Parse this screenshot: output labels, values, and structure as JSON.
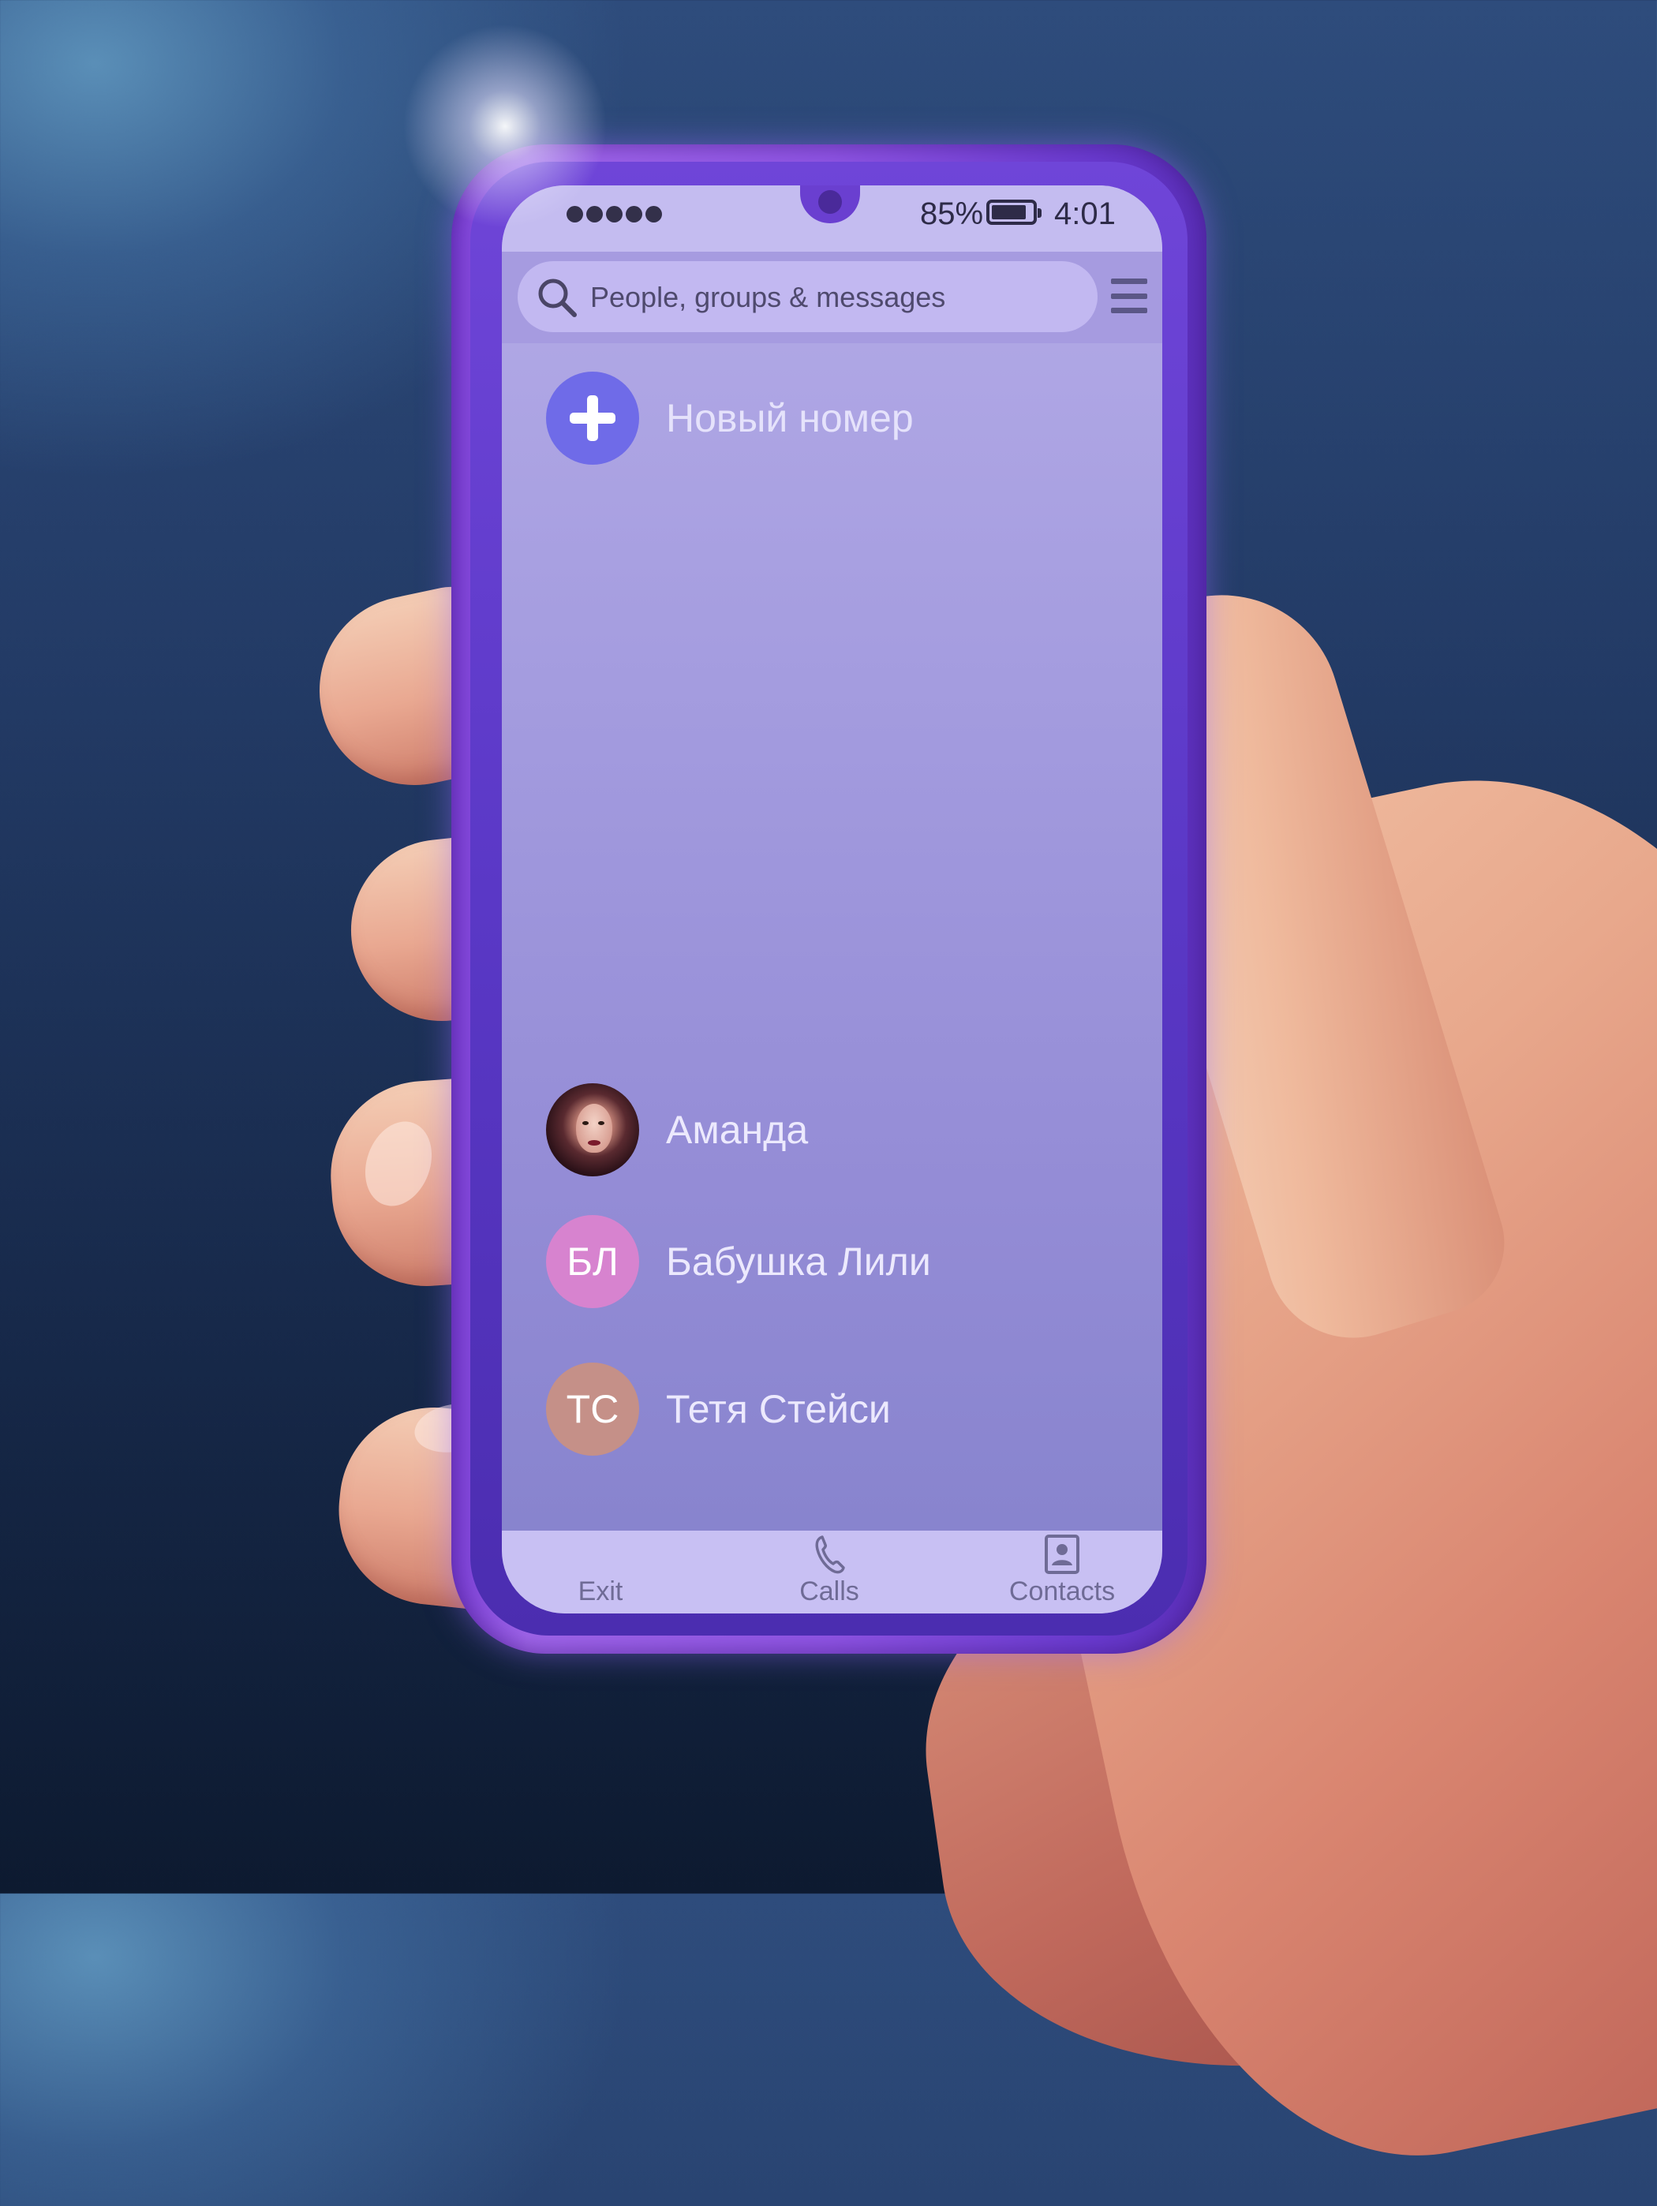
{
  "status_bar": {
    "signal_dots": 5,
    "battery_percent": "85%",
    "battery_level": 0.85,
    "time": "4:01"
  },
  "search": {
    "placeholder": "People, groups & messages",
    "icon": "search-icon"
  },
  "header": {
    "menu_icon": "hamburger-menu-icon"
  },
  "new_number": {
    "label": "Новый номер",
    "icon": "plus-icon",
    "color": "#6f6be8"
  },
  "contacts": [
    {
      "name": "Аманда",
      "avatar_type": "photo"
    },
    {
      "name": "Бабушка Лили",
      "initials": "БЛ",
      "color": "#d783cf"
    },
    {
      "name": "Тетя Стейси",
      "initials": "ТС",
      "color": "#c59088"
    }
  ],
  "bottom_nav": [
    {
      "label": "Exit",
      "icon": ""
    },
    {
      "label": "Calls",
      "icon": "phone-icon"
    },
    {
      "label": "Contacts",
      "icon": "contact-card-icon"
    }
  ],
  "colors": {
    "phone_frame": "#8f55e4",
    "screen_top": "#b4abe7",
    "screen_bottom": "#8582cc",
    "header_bg": "#a69be0",
    "bottom_nav_bg": "#c8c0f3"
  }
}
